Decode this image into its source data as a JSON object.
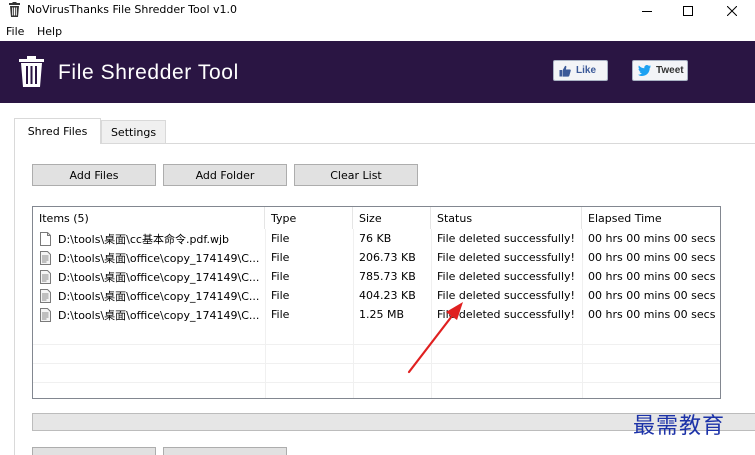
{
  "window": {
    "title": "NoVirusThanks File Shredder Tool v1.0",
    "controls": {
      "minimize": "minimize-icon",
      "maximize": "maximize-icon",
      "close": "close-icon"
    }
  },
  "menu": {
    "items": [
      "File",
      "Help"
    ]
  },
  "header": {
    "app_title": "File Shredder Tool",
    "like_label": "Like",
    "tweet_label": "Tweet",
    "background_color": "#2a1543"
  },
  "tabs": [
    {
      "label": "Shred Files",
      "active": true
    },
    {
      "label": "Settings",
      "active": false
    }
  ],
  "toolbar": {
    "add_files": "Add Files",
    "add_folder": "Add Folder",
    "clear_list": "Clear List"
  },
  "list": {
    "columns": [
      "Items (5)",
      "Type",
      "Size",
      "Status",
      "Elapsed Time"
    ],
    "rows": [
      {
        "item": "D:\\tools\\桌面\\cc基本命令.pdf.wjb",
        "type": "File",
        "size": "76 KB",
        "status": "File deleted successfully!",
        "elapsed": "00 hrs 00 mins 00 secs",
        "icon": "blank-document-icon"
      },
      {
        "item": "D:\\tools\\桌面\\office\\copy_174149\\C...",
        "type": "File",
        "size": "206.73 KB",
        "status": "File deleted successfully!",
        "elapsed": "00 hrs 00 mins 00 secs",
        "icon": "text-document-icon"
      },
      {
        "item": "D:\\tools\\桌面\\office\\copy_174149\\C...",
        "type": "File",
        "size": "785.73 KB",
        "status": "File deleted successfully!",
        "elapsed": "00 hrs 00 mins 00 secs",
        "icon": "text-document-icon"
      },
      {
        "item": "D:\\tools\\桌面\\office\\copy_174149\\C...",
        "type": "File",
        "size": "404.23 KB",
        "status": "File deleted successfully!",
        "elapsed": "00 hrs 00 mins 00 secs",
        "icon": "text-document-icon"
      },
      {
        "item": "D:\\tools\\桌面\\office\\copy_174149\\C...",
        "type": "File",
        "size": "1.25 MB",
        "status": "File deleted successfully!",
        "elapsed": "00 hrs 00 mins 00 secs",
        "icon": "text-document-icon"
      }
    ]
  },
  "watermark": "最需教育",
  "annotation": {
    "arrow_color": "#e02020"
  }
}
